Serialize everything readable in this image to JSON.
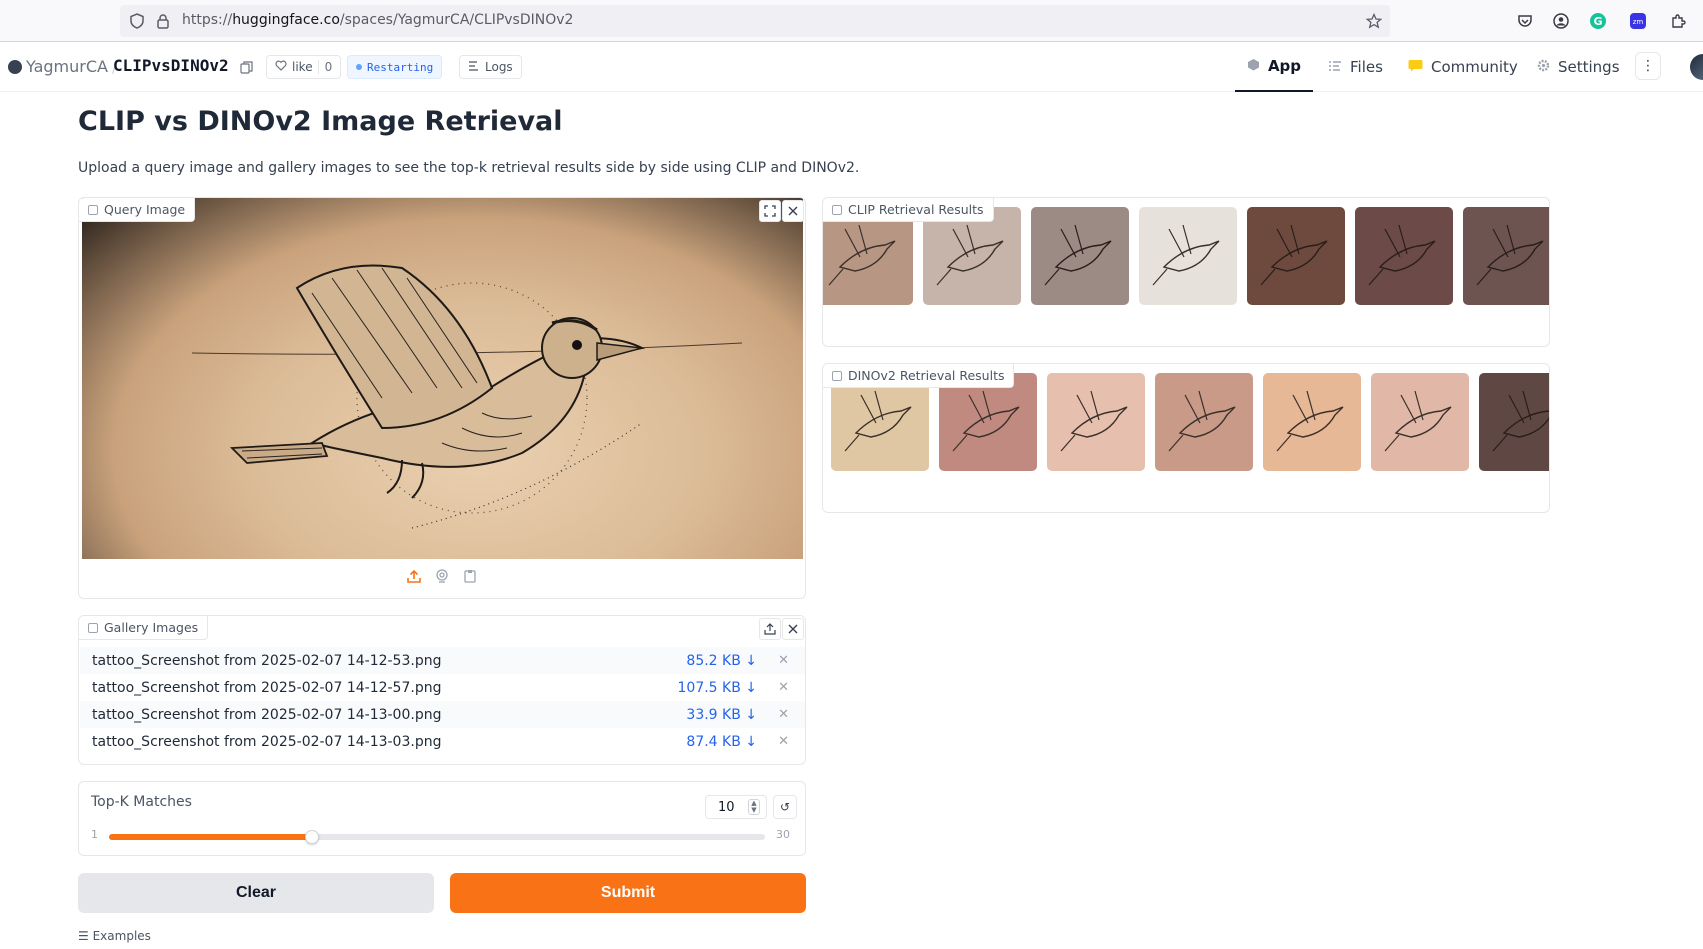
{
  "browser": {
    "url_prefix": "https://",
    "url_host": "huggingface.co",
    "url_path": "/spaces/YagmurCA/CLIPvsDINOv2"
  },
  "header": {
    "owner": "YagmurCA",
    "separator": "/",
    "repo": "CLIPvsDINOv2",
    "like_label": "like",
    "like_count": "0",
    "status": "Restarting",
    "logs_label": "Logs",
    "tabs": [
      {
        "label": "App",
        "icon": "app-cube-icon"
      },
      {
        "label": "Files",
        "icon": "files-icon"
      },
      {
        "label": "Community",
        "icon": "community-icon"
      },
      {
        "label": "Settings",
        "icon": "gear-icon"
      }
    ]
  },
  "app": {
    "title": "CLIP vs DINOv2 Image Retrieval",
    "description": "Upload a query image and gallery images to see the top-k retrieval results side by side using CLIP and DINOv2.",
    "query_label": "Query Image",
    "clip_label": "CLIP Retrieval Results",
    "dino_label": "DINOv2 Retrieval Results",
    "gallery_label": "Gallery Images",
    "gallery_files": [
      {
        "name": "tattoo_Screenshot from 2025-02-07 14-12-53.png",
        "size": "85.2 KB ↓"
      },
      {
        "name": "tattoo_Screenshot from 2025-02-07 14-12-57.png",
        "size": "107.5 KB ↓"
      },
      {
        "name": "tattoo_Screenshot from 2025-02-07 14-13-00.png",
        "size": "33.9 KB ↓"
      },
      {
        "name": "tattoo_Screenshot from 2025-02-07 14-13-03.png",
        "size": "87.4 KB ↓"
      }
    ],
    "topk": {
      "label": "Top-K Matches",
      "value": "10",
      "min": "1",
      "max": "30",
      "fill_fraction": 0.31
    },
    "clear_label": "Clear",
    "submit_label": "Submit",
    "examples_label": "Examples"
  },
  "colors": {
    "accent": "#f97316",
    "link": "#2563eb"
  }
}
